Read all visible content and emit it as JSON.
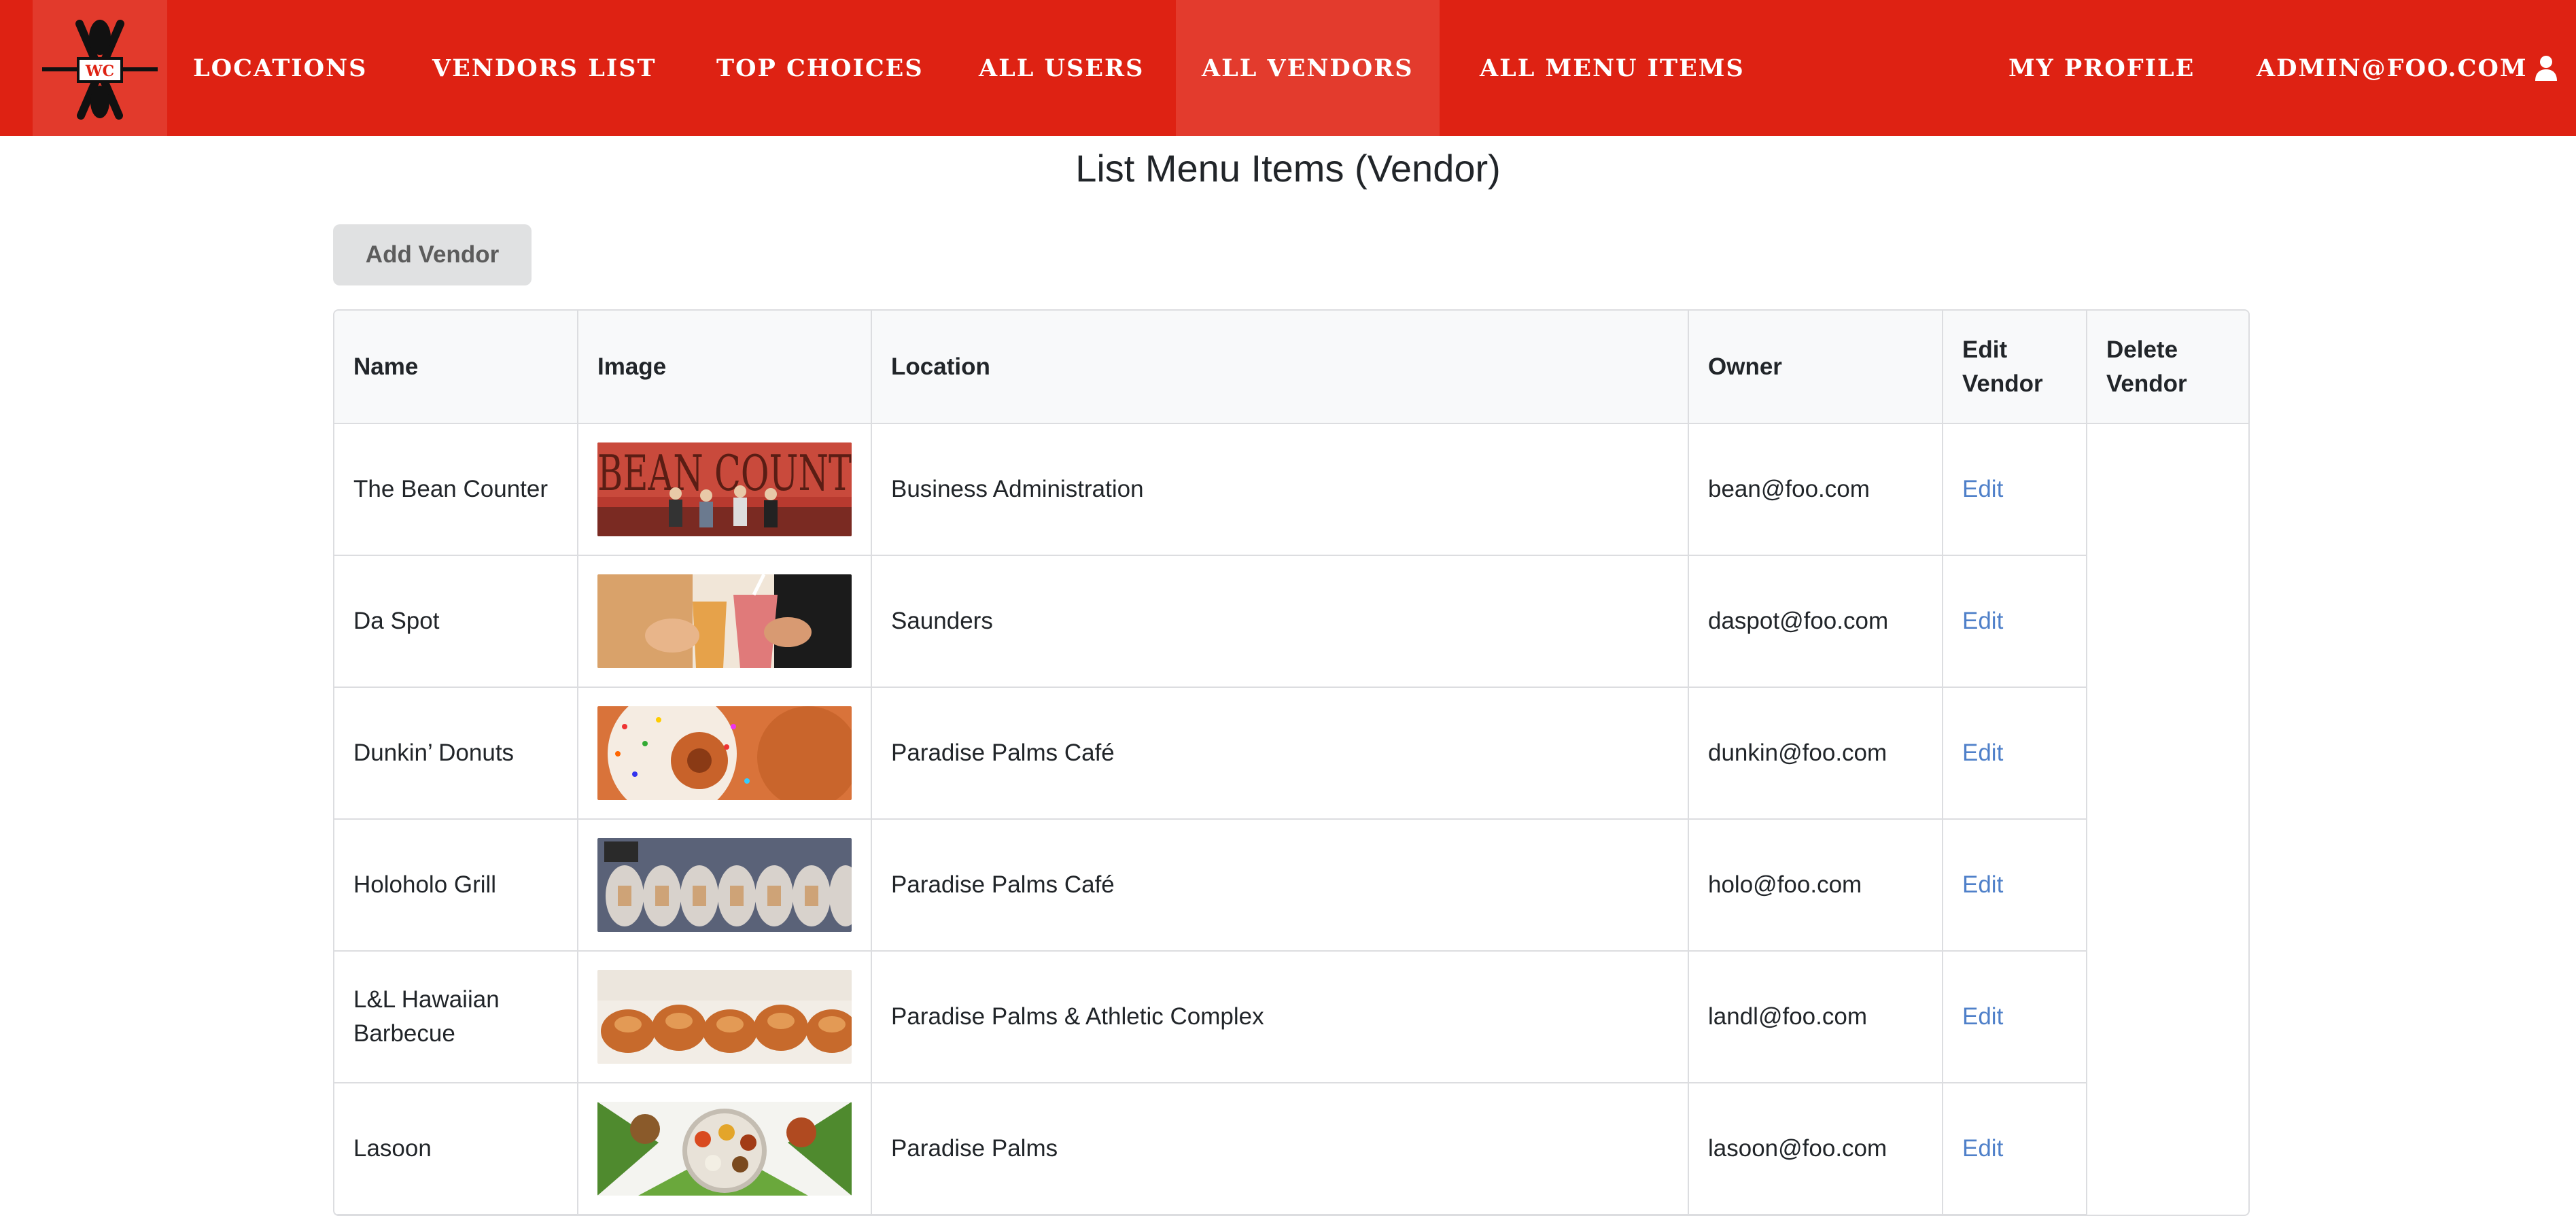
{
  "nav": {
    "logo_text": "WC",
    "items": [
      {
        "label": "Locations"
      },
      {
        "label": "Vendors List"
      },
      {
        "label": "Top Choices"
      },
      {
        "label": "All Users"
      },
      {
        "label": "All Vendors"
      },
      {
        "label": "All Menu Items"
      }
    ],
    "active": "All Vendors",
    "profile_label": "My Profile",
    "user_label": "admin@foo.com",
    "user_icon": "user-icon"
  },
  "page": {
    "title": "List Menu Items (Vendor)",
    "add_button_label": "Add Vendor"
  },
  "table": {
    "headers": [
      "Name",
      "Image",
      "Location",
      "Owner",
      "Edit Vendor",
      "Delete Vendor"
    ],
    "rows": [
      {
        "name": "The Bean Counter",
        "image": "coffee-shop-photo",
        "location": "Business Administration",
        "owner": "bean@foo.com",
        "edit": "Edit"
      },
      {
        "name": "Da Spot",
        "image": "smoothie-drinks-photo",
        "location": "Saunders",
        "owner": "daspot@foo.com",
        "edit": "Edit"
      },
      {
        "name": "Dunkin’ Donuts",
        "image": "donut-photo",
        "location": "Paradise Palms Café",
        "owner": "dunkin@foo.com",
        "edit": "Edit"
      },
      {
        "name": "Holoholo Grill",
        "image": "wrapped-musubi-photo",
        "location": "Paradise Palms Café",
        "owner": "holo@foo.com",
        "edit": "Edit"
      },
      {
        "name": "L&L Hawaiian Barbecue",
        "image": "fried-chicken-plate-photo",
        "location": "Paradise Palms & Athletic Complex",
        "owner": "landl@foo.com",
        "edit": "Edit"
      },
      {
        "name": "Lasoon",
        "image": "thali-platter-photo",
        "location": "Paradise Palms",
        "owner": "lasoon@foo.com",
        "edit": "Edit"
      }
    ]
  },
  "colors": {
    "navbar": "#de2213",
    "navbar_active": "#e33b2d",
    "link": "#4f80c9",
    "button_bg": "#e0e1e2"
  }
}
